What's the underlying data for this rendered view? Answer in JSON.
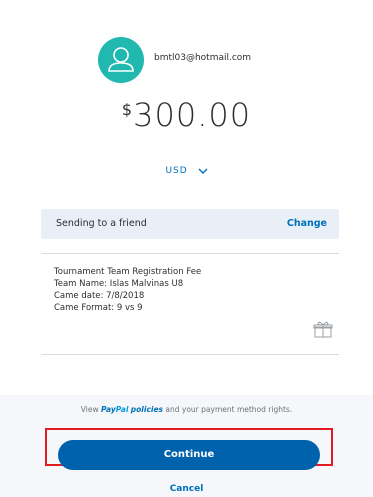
{
  "recipient": {
    "email": "bmtl03@hotmail.com",
    "avatar_icon": "person-icon",
    "avatar_color": "#21b8b0"
  },
  "amount": {
    "symbol": "$",
    "value": "300.00"
  },
  "currency": {
    "code": "USD",
    "icon": "chevron-down-icon"
  },
  "payment_type": {
    "label": "Sending to a friend",
    "change_label": "Change"
  },
  "note": {
    "lines": [
      "Tournament Team Registration Fee",
      "Team Name: Islas Malvinas U8",
      "Came date: 7/8/2018",
      "Came Format: 9 vs 9"
    ],
    "icon": "gift-icon"
  },
  "footer": {
    "policy_prefix": "View",
    "policy_brand_1": "Pay",
    "policy_brand_2": "Pal",
    "policy_link": "policies",
    "policy_suffix": "and your payment method rights.",
    "continue_label": "Continue",
    "cancel_label": "Cancel"
  },
  "colors": {
    "link": "#0070ba",
    "primary_button": "#0061ad",
    "highlight_border": "#e21b23",
    "info_box": "#e8eff7"
  }
}
